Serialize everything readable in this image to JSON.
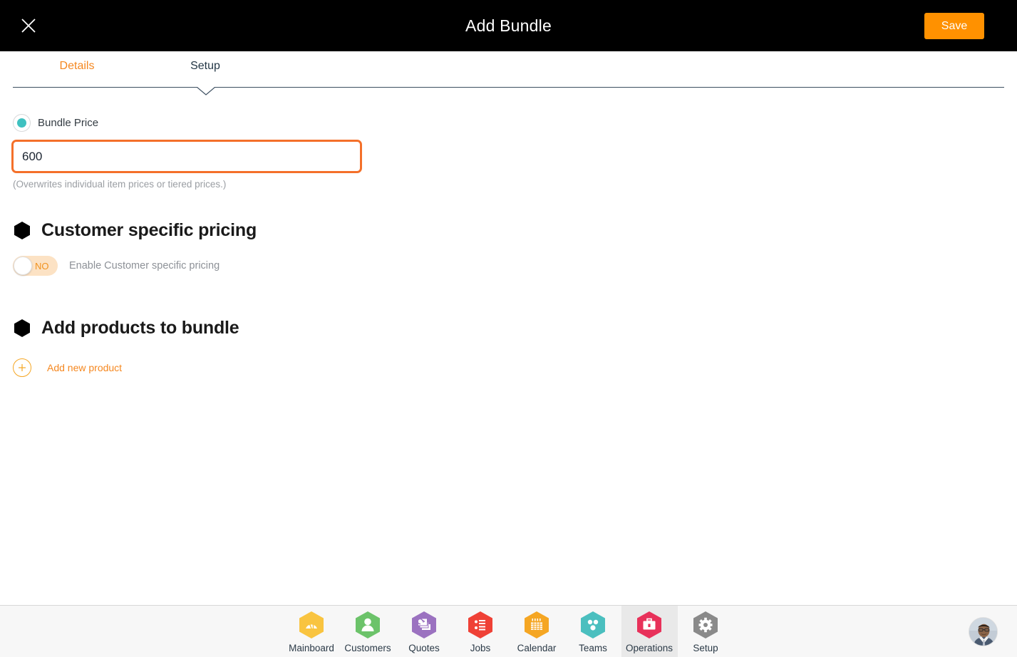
{
  "header": {
    "title": "Add Bundle",
    "close_icon": "close-icon",
    "save_label": "Save",
    "save_color": "#FF9100"
  },
  "tabs": [
    {
      "label": "Details",
      "active": false,
      "color": "#F5871F"
    },
    {
      "label": "Setup",
      "active": true,
      "color": "#243746"
    }
  ],
  "form": {
    "radio": {
      "label": "Bundle Price",
      "selected": true,
      "dot_color": "#3FC1C0"
    },
    "price_input": {
      "value": "600",
      "placeholder": "",
      "focused": true,
      "focus_border_color": "#F4702A"
    },
    "price_hint": "(Overwrites individual item prices or tiered prices.)"
  },
  "sections": [
    {
      "title": "Customer specific pricing",
      "bullet_icon": "hexagon-icon",
      "toggle": {
        "state_label": "NO",
        "enabled": false,
        "description": "Enable Customer specific pricing",
        "track_color": "#FCE2C4",
        "text_color": "#F0921F"
      }
    },
    {
      "title": "Add products to bundle",
      "bullet_icon": "hexagon-icon",
      "add_action": {
        "icon": "plus-circle-icon",
        "label": "Add new product",
        "color": "#F5871F"
      }
    }
  ],
  "bottom_nav": {
    "items": [
      {
        "label": "Mainboard",
        "icon": "dashboard-icon",
        "color": "#F9C440",
        "active": false
      },
      {
        "label": "Customers",
        "icon": "person-icon",
        "color": "#6CC36A",
        "active": false
      },
      {
        "label": "Quotes",
        "icon": "documents-icon",
        "color": "#A islands",
        "active": false
      },
      {
        "label": "Jobs",
        "icon": "list-icon",
        "color": "#EF4136",
        "active": false
      },
      {
        "label": "Calendar",
        "icon": "calendar-icon",
        "color": "#F5A623",
        "active": false
      },
      {
        "label": "Teams",
        "icon": "group-dots-icon",
        "color": "#4BBFBF",
        "active": false
      },
      {
        "label": "Operations",
        "icon": "briefcase-icon",
        "color": "#E8315A",
        "active": true
      },
      {
        "label": "Setup",
        "icon": "gear-icon",
        "color": "#8A8A8A",
        "active": false
      }
    ],
    "avatar": "user-avatar"
  }
}
